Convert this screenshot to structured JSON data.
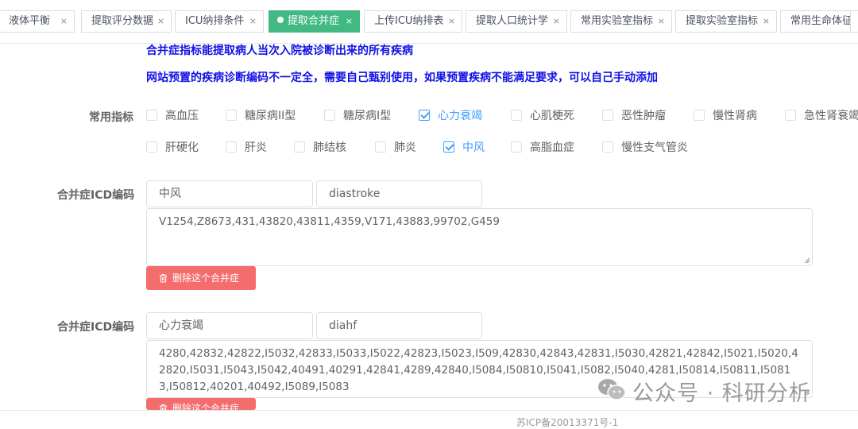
{
  "tabs": [
    {
      "label": "液体平衡",
      "active": false
    },
    {
      "label": "提取评分数据",
      "active": false
    },
    {
      "label": "ICU纳排条件",
      "active": false
    },
    {
      "label": "提取合并症",
      "active": true
    },
    {
      "label": "上传ICU纳排表",
      "active": false
    },
    {
      "label": "提取人口统计学",
      "active": false
    },
    {
      "label": "常用实验室指标",
      "active": false
    },
    {
      "label": "提取实验室指标",
      "active": false
    },
    {
      "label": "常用生命体征",
      "active": false
    }
  ],
  "close_glyph": "×",
  "notice": {
    "line1": "合并症指标能提取病人当次入院被诊断出来的所有疾病",
    "line2": "网站预置的疾病诊断编码不一定全，需要自己甄别使用，如果预置疾病不能满足要求，可以自己手动添加"
  },
  "common_label": "常用指标",
  "checkboxes": [
    {
      "label": "高血压",
      "checked": false
    },
    {
      "label": "糖尿病II型",
      "checked": false
    },
    {
      "label": "糖尿病I型",
      "checked": false
    },
    {
      "label": "心力衰竭",
      "checked": true
    },
    {
      "label": "心肌梗死",
      "checked": false
    },
    {
      "label": "恶性肿瘤",
      "checked": false
    },
    {
      "label": "慢性肾病",
      "checked": false
    },
    {
      "label": "急性肾衰竭",
      "checked": false
    },
    {
      "label": "肝硬化",
      "checked": false
    },
    {
      "label": "肝炎",
      "checked": false
    },
    {
      "label": "肺结核",
      "checked": false
    },
    {
      "label": "肺炎",
      "checked": false
    },
    {
      "label": "中风",
      "checked": true
    },
    {
      "label": "高脂血症",
      "checked": false
    },
    {
      "label": "慢性支气管炎",
      "checked": false
    }
  ],
  "icd_label": "合并症ICD编码",
  "comorbidities": [
    {
      "name": "中风",
      "var": "diastroke",
      "codes": "V1254,Z8673,431,43820,43811,4359,V171,43883,99702,G459",
      "delete_label": "删除这个合并症"
    },
    {
      "name": "心力衰竭",
      "var": "diahf",
      "codes": "4280,42832,42822,I5032,42833,I5033,I5022,42823,I5023,I509,42830,42843,42831,I5030,42821,42842,I5021,I5020,42820,I5031,I5043,I5042,40491,40291,42841,4289,42840,I5084,I50810,I5041,I5082,I5040,4281,I50814,I50811,I50813,I50812,40201,40492,I5089,I5083",
      "delete_label": "删除这个合并症"
    }
  ],
  "watermark": "公众号 · 科研分析",
  "footer_text": "苏ICP备20013371号-1",
  "colors": {
    "active_tab": "#42b983",
    "checked": "#409eff",
    "notice": "#1010e6",
    "danger": "#f56c6c"
  }
}
